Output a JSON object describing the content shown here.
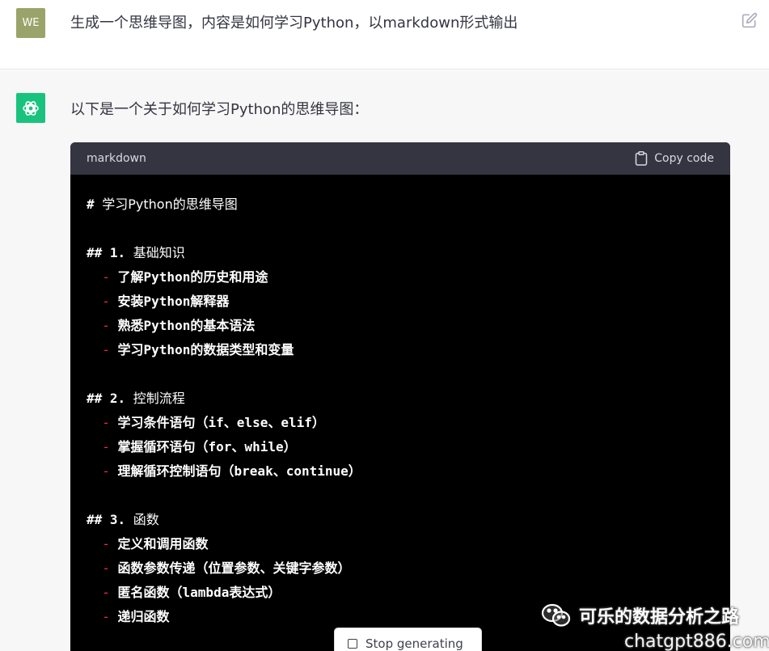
{
  "user": {
    "avatar_text": "WE",
    "message": "生成一个思维导图，内容是如何学习Python，以markdown形式输出",
    "edit_icon": "edit-icon"
  },
  "assistant": {
    "avatar_icon": "openai-logo-icon",
    "intro": "以下是一个关于如何学习Python的思维导图："
  },
  "code": {
    "language": "markdown",
    "copy_label": "Copy code",
    "lines": [
      {
        "kind": "h1",
        "marker": "# ",
        "text": "学习Python的思维导图"
      },
      {
        "kind": "blank"
      },
      {
        "kind": "h2",
        "marker": "## 1. ",
        "text": "基础知识"
      },
      {
        "kind": "item",
        "text": "了解Python的历史和用途"
      },
      {
        "kind": "item",
        "text": "安装Python解释器"
      },
      {
        "kind": "item",
        "text": "熟悉Python的基本语法"
      },
      {
        "kind": "item",
        "text": "学习Python的数据类型和变量"
      },
      {
        "kind": "blank"
      },
      {
        "kind": "h2",
        "marker": "## 2. ",
        "text": "控制流程"
      },
      {
        "kind": "item",
        "text": "学习条件语句（if、else、elif）"
      },
      {
        "kind": "item",
        "text": "掌握循环语句（for、while）"
      },
      {
        "kind": "item",
        "text": "理解循环控制语句（break、continue）"
      },
      {
        "kind": "blank"
      },
      {
        "kind": "h2",
        "marker": "## 3. ",
        "text": "函数"
      },
      {
        "kind": "item",
        "text": "定义和调用函数"
      },
      {
        "kind": "item",
        "text": "函数参数传递（位置参数、关键字参数）"
      },
      {
        "kind": "item",
        "text": "匿名函数（lambda表达式）"
      },
      {
        "kind": "item",
        "text": "递归函数"
      }
    ]
  },
  "stop_button": {
    "label": "Stop generating"
  },
  "watermark": {
    "line1": "可乐的数据分析之路",
    "line2": "chatgpt886.com"
  },
  "colors": {
    "user_avatar": "#9aa46a",
    "gpt_avatar": "#19c37d",
    "code_bg": "#000000",
    "code_header_bg": "#343541",
    "list_dash": "#f22c3d"
  }
}
